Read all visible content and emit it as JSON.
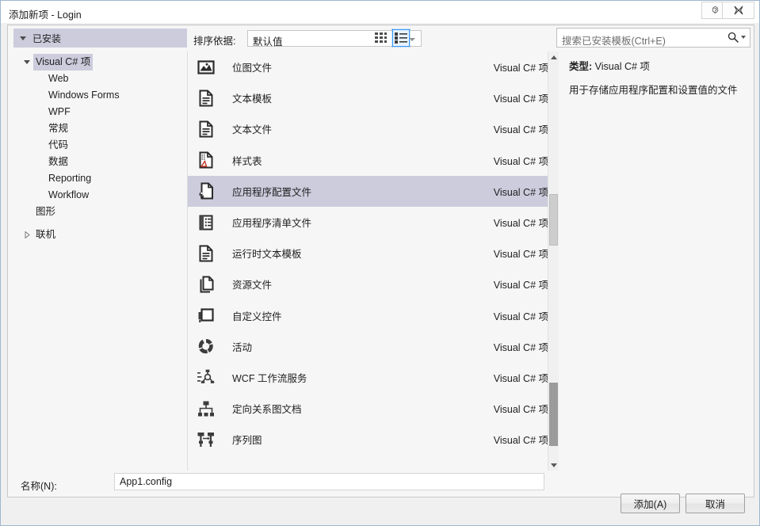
{
  "window": {
    "title": "添加新项 - Login",
    "help_button": "?",
    "close_button": "✕"
  },
  "sidebar": {
    "header": "已安装",
    "nodes": [
      {
        "label": "Visual C# 项",
        "level": 1,
        "expandable": true,
        "expanded": true,
        "selected": true
      },
      {
        "label": "Web",
        "level": 2,
        "expandable": false,
        "expanded": false,
        "selected": false
      },
      {
        "label": "Windows Forms",
        "level": 2,
        "expandable": false,
        "expanded": false,
        "selected": false
      },
      {
        "label": "WPF",
        "level": 2,
        "expandable": false,
        "expanded": false,
        "selected": false
      },
      {
        "label": "常规",
        "level": 2,
        "expandable": false,
        "expanded": false,
        "selected": false
      },
      {
        "label": "代码",
        "level": 2,
        "expandable": false,
        "expanded": false,
        "selected": false
      },
      {
        "label": "数据",
        "level": 2,
        "expandable": false,
        "expanded": false,
        "selected": false
      },
      {
        "label": "Reporting",
        "level": 2,
        "expandable": false,
        "expanded": false,
        "selected": false
      },
      {
        "label": "Workflow",
        "level": 2,
        "expandable": false,
        "expanded": false,
        "selected": false
      },
      {
        "label": "图形",
        "level": "1b",
        "expandable": false,
        "expanded": false,
        "selected": false
      },
      {
        "label": "联机",
        "level": 1,
        "expandable": true,
        "expanded": false,
        "selected": false
      }
    ]
  },
  "toolbar": {
    "sort_label": "排序依据:",
    "sort_value": "默认值",
    "view_tiles_name": "medium-icons-view",
    "view_list_name": "list-view"
  },
  "search": {
    "placeholder": "搜索已安装模板(Ctrl+E)",
    "icon": "search-icon"
  },
  "templates": [
    {
      "name": "位图文件",
      "kind": "Visual C# 项",
      "icon": "bitmap-file-icon",
      "selected": false
    },
    {
      "name": "文本模板",
      "kind": "Visual C# 项",
      "icon": "text-template-icon",
      "selected": false
    },
    {
      "name": "文本文件",
      "kind": "Visual C# 项",
      "icon": "text-file-icon",
      "selected": false
    },
    {
      "name": "样式表",
      "kind": "Visual C# 项",
      "icon": "stylesheet-icon",
      "selected": false
    },
    {
      "name": "应用程序配置文件",
      "kind": "Visual C# 项",
      "icon": "app-config-file-icon",
      "selected": true
    },
    {
      "name": "应用程序清单文件",
      "kind": "Visual C# 项",
      "icon": "app-manifest-file-icon",
      "selected": false
    },
    {
      "name": "运行时文本模板",
      "kind": "Visual C# 项",
      "icon": "runtime-text-template-icon",
      "selected": false
    },
    {
      "name": "资源文件",
      "kind": "Visual C# 项",
      "icon": "resource-file-icon",
      "selected": false
    },
    {
      "name": "自定义控件",
      "kind": "Visual C# 项",
      "icon": "custom-control-icon",
      "selected": false
    },
    {
      "name": "活动",
      "kind": "Visual C# 项",
      "icon": "activity-icon",
      "selected": false
    },
    {
      "name": "WCF 工作流服务",
      "kind": "Visual C# 项",
      "icon": "wcf-workflow-service-icon",
      "selected": false
    },
    {
      "name": "定向关系图文档",
      "kind": "Visual C# 项",
      "icon": "directed-graph-document-icon",
      "selected": false
    },
    {
      "name": "序列图",
      "kind": "Visual C# 项",
      "icon": "sequence-diagram-icon",
      "selected": false
    }
  ],
  "details": {
    "type_label": "类型:",
    "type_value": "Visual C# 项",
    "description": "用于存储应用程序配置和设置值的文件"
  },
  "name_field": {
    "label": "名称(N):",
    "value": "App1.config"
  },
  "footer": {
    "add_label": "添加(A)",
    "cancel_label": "取消"
  },
  "colors": {
    "selection": "#ccccdd",
    "accent_border": "#3399ff",
    "window_border": "#9fb6cd",
    "panel_background": "#f6f6f6"
  }
}
